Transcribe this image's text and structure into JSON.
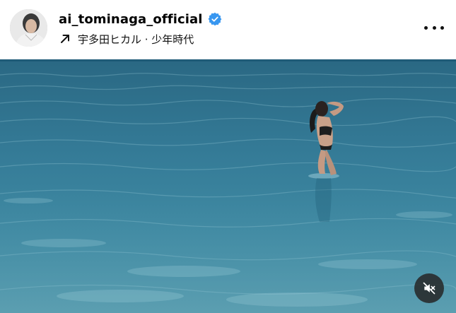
{
  "post": {
    "username": "ai_tominaga_official",
    "verified": true,
    "music_label": "宇多田ヒカル · 少年時代",
    "more_icon": "more-horizontal-icon"
  },
  "media": {
    "type": "video",
    "scene": "photo",
    "mute_icon": "speaker-muted-icon"
  },
  "colors": {
    "verified_badge": "#3897f0",
    "sea_top": "#2d6f8c",
    "sea_bottom": "#3f8ea8",
    "mute_bg": "#262626"
  }
}
